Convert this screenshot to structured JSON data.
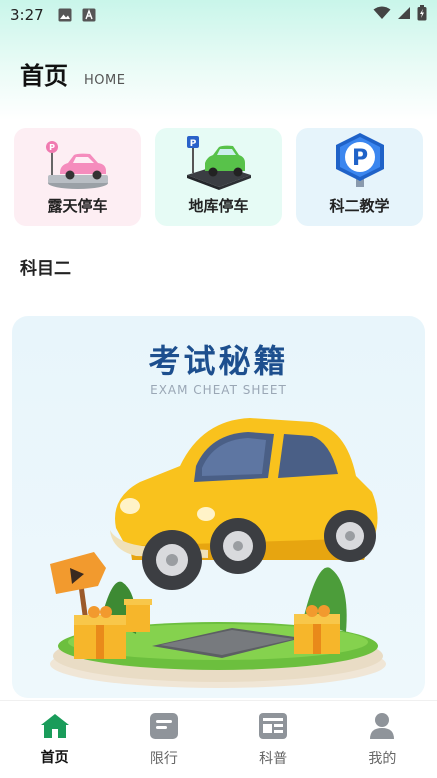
{
  "status_bar": {
    "time": "3:27"
  },
  "header": {
    "title": "首页",
    "subtitle": "HOME"
  },
  "quick_cards": [
    {
      "label": "露天停车",
      "icon": "outdoor-parking-icon",
      "bg": "#fdeef3"
    },
    {
      "label": "地库停车",
      "icon": "garage-parking-icon",
      "bg": "#e6fbf5"
    },
    {
      "label": "科二教学",
      "icon": "parking-sign-icon",
      "bg": "#e6f4fb"
    }
  ],
  "section": {
    "title": "科目二"
  },
  "banner": {
    "title": "考试秘籍",
    "subtitle": "EXAM CHEAT SHEET"
  },
  "tabs": [
    {
      "label": "首页",
      "icon": "home-icon",
      "active": true
    },
    {
      "label": "限行",
      "icon": "note-icon",
      "active": false
    },
    {
      "label": "科普",
      "icon": "news-icon",
      "active": false
    },
    {
      "label": "我的",
      "icon": "user-icon",
      "active": false
    }
  ],
  "colors": {
    "accent": "#1a9c5a",
    "banner_title": "#1d4f8e",
    "car": "#f9c21d"
  }
}
